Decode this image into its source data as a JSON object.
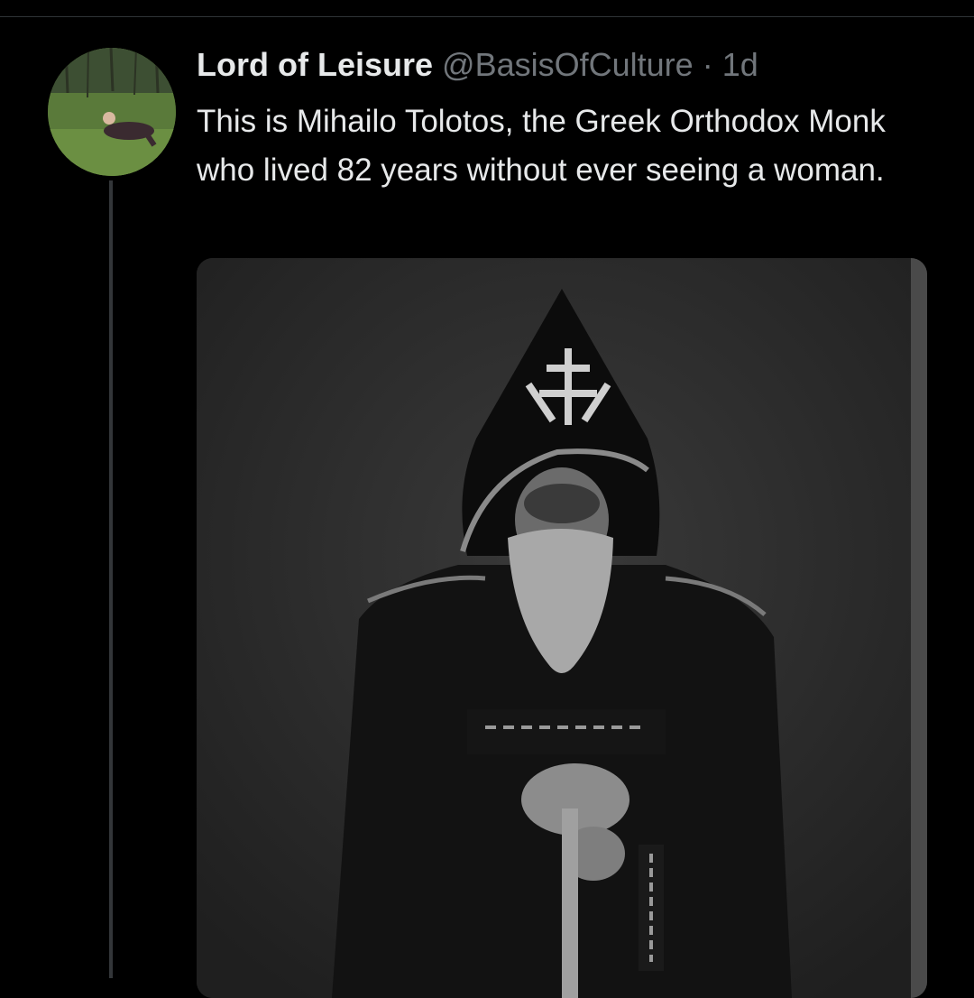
{
  "tweet": {
    "display_name": "Lord of Leisure",
    "handle": "@BasisOfCulture",
    "separator": "·",
    "time": "1d",
    "text": "This is Mihailo Tolotos, the Greek Orthodox Monk who lived 82 years without ever seeing a woman."
  },
  "avatar": {
    "icon": "avatar-photo-person-lying-on-grass"
  },
  "media": {
    "icon": "photo-monk-in-hooded-robe"
  },
  "colors": {
    "background": "#000000",
    "text_primary": "#e7e9ea",
    "text_secondary": "#71767b",
    "thread_line": "#333639"
  }
}
